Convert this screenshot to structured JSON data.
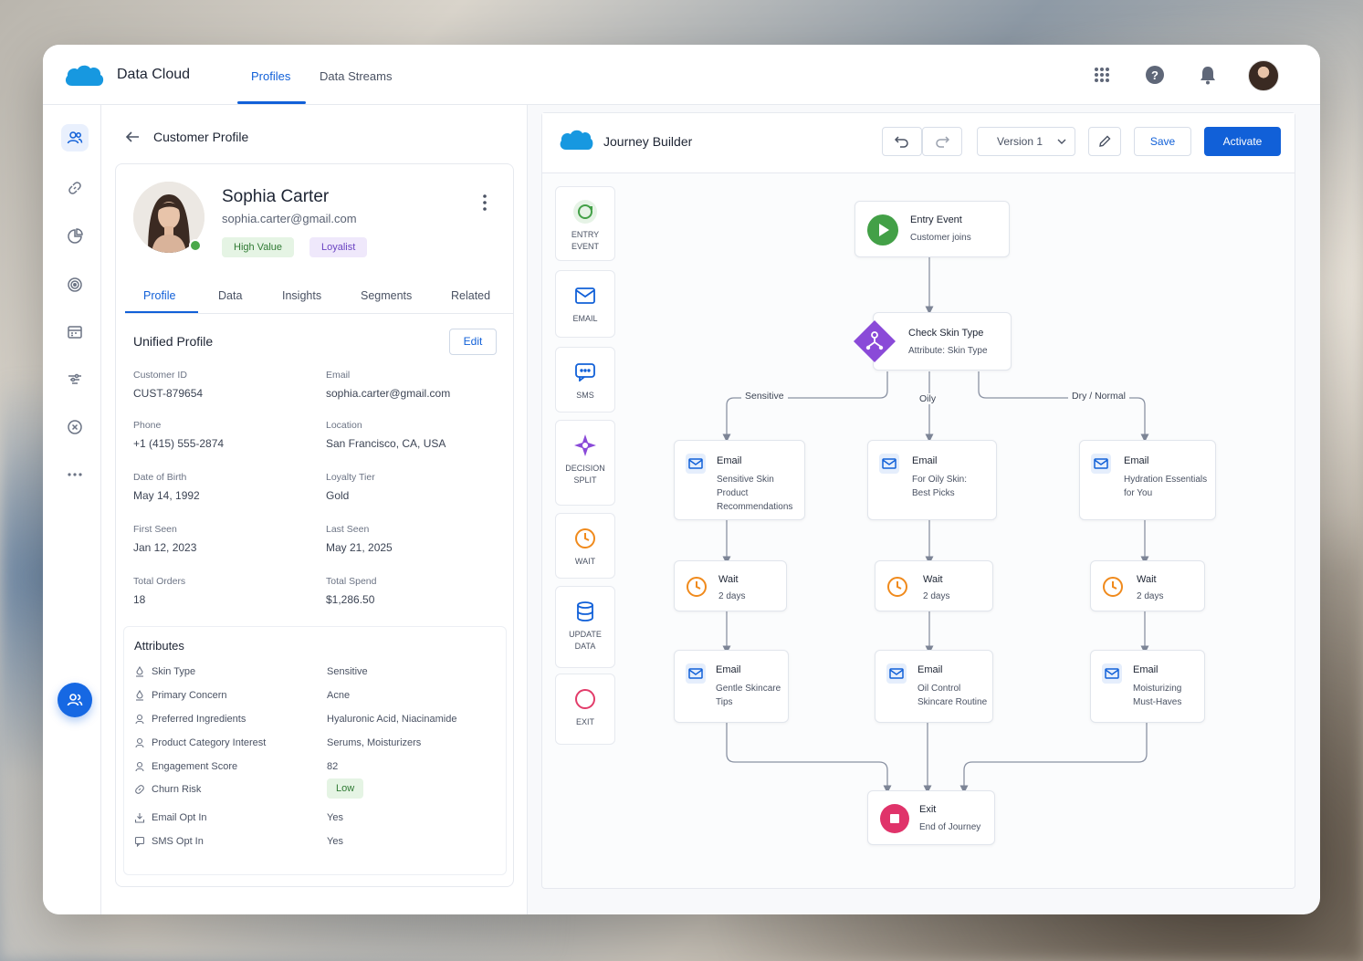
{
  "app": {
    "title": "Data Cloud",
    "nav": [
      "Profiles",
      "Data Streams"
    ]
  },
  "rail": {
    "icons": [
      "users-icon",
      "link-icon",
      "pie-chart-icon",
      "target-icon",
      "calendar-icon",
      "filter-icon",
      "close-circle-icon",
      "more-icon"
    ]
  },
  "profile": {
    "panel_title": "Customer Profile",
    "name": "Sophia Carter",
    "email": "sophia.carter@gmail.com",
    "badges": [
      "High Value",
      "Loyalist"
    ],
    "tabs": [
      "Profile",
      "Data",
      "Insights",
      "Segments",
      "Related"
    ],
    "unified_title": "Unified Profile",
    "edit_label": "Edit",
    "fields": [
      {
        "label": "Customer ID",
        "value": "CUST-879654"
      },
      {
        "label": "Email",
        "value": "sophia.carter@gmail.com"
      },
      {
        "label": "Phone",
        "value": "+1 (415) 555-2874"
      },
      {
        "label": "Location",
        "value": "San Francisco, CA, USA"
      },
      {
        "label": "Date of Birth",
        "value": "May 14, 1992"
      },
      {
        "label": "Loyalty Tier",
        "value": "Gold"
      },
      {
        "label": "First Seen",
        "value": "Jan 12, 2023"
      },
      {
        "label": "Last Seen",
        "value": "May 21, 2025"
      },
      {
        "label": "Total Orders",
        "value": "18"
      },
      {
        "label": "Total Spend",
        "value": "$1,286.50"
      }
    ],
    "attributes_title": "Attributes",
    "attributes": [
      {
        "label": "Skin Type",
        "value": "Sensitive"
      },
      {
        "label": "Primary Concern",
        "value": "Acne"
      },
      {
        "label": "Preferred Ingredients",
        "value": "Hyaluronic Acid, Niacinamide"
      },
      {
        "label": "Product Category Interest",
        "value": "Serums, Moisturizers"
      },
      {
        "label": "Engagement Score",
        "value": "82"
      },
      {
        "label": "Churn Risk",
        "value": "Low"
      },
      {
        "label": "Email Opt In",
        "value": "Yes"
      },
      {
        "label": "SMS Opt In",
        "value": "Yes"
      }
    ]
  },
  "journey": {
    "title": "Journey Builder",
    "version": "Version 1",
    "save_label": "Save",
    "activate_label": "Activate",
    "palette": [
      [
        "ENTRY",
        "EVENT"
      ],
      [
        "EMAIL"
      ],
      [
        "SMS"
      ],
      [
        "DECISION",
        "SPLIT"
      ],
      [
        "WAIT"
      ],
      [
        "UPDATE",
        "DATA"
      ],
      [
        "EXIT"
      ]
    ],
    "entry": {
      "title": "Entry Event",
      "sub": "Customer joins"
    },
    "split": {
      "title": "Check Skin Type",
      "sub": "Attribute: Skin Type"
    },
    "branches": [
      "Sensitive",
      "Oily",
      "Dry / Normal"
    ],
    "email1": [
      {
        "title": "Email",
        "sub": [
          "Sensitive Skin",
          "Product",
          "Recommendations"
        ]
      },
      {
        "title": "Email",
        "sub": [
          "For Oily Skin:",
          "Best Picks"
        ]
      },
      {
        "title": "Email",
        "sub": [
          "Hydration Essentials",
          "for You"
        ]
      }
    ],
    "waits": [
      {
        "title": "Wait",
        "sub": "2 days"
      },
      {
        "title": "Wait",
        "sub": "2 days"
      },
      {
        "title": "Wait",
        "sub": "2 days"
      }
    ],
    "email2": [
      {
        "title": "Email",
        "sub": [
          "Gentle Skincare",
          "Tips"
        ]
      },
      {
        "title": "Email",
        "sub": [
          "Oil Control",
          "Skincare Routine"
        ]
      },
      {
        "title": "Email",
        "sub": [
          "Moisturizing",
          "Must-Haves"
        ]
      }
    ],
    "exit": {
      "title": "Exit",
      "sub": "End of Journey"
    }
  }
}
